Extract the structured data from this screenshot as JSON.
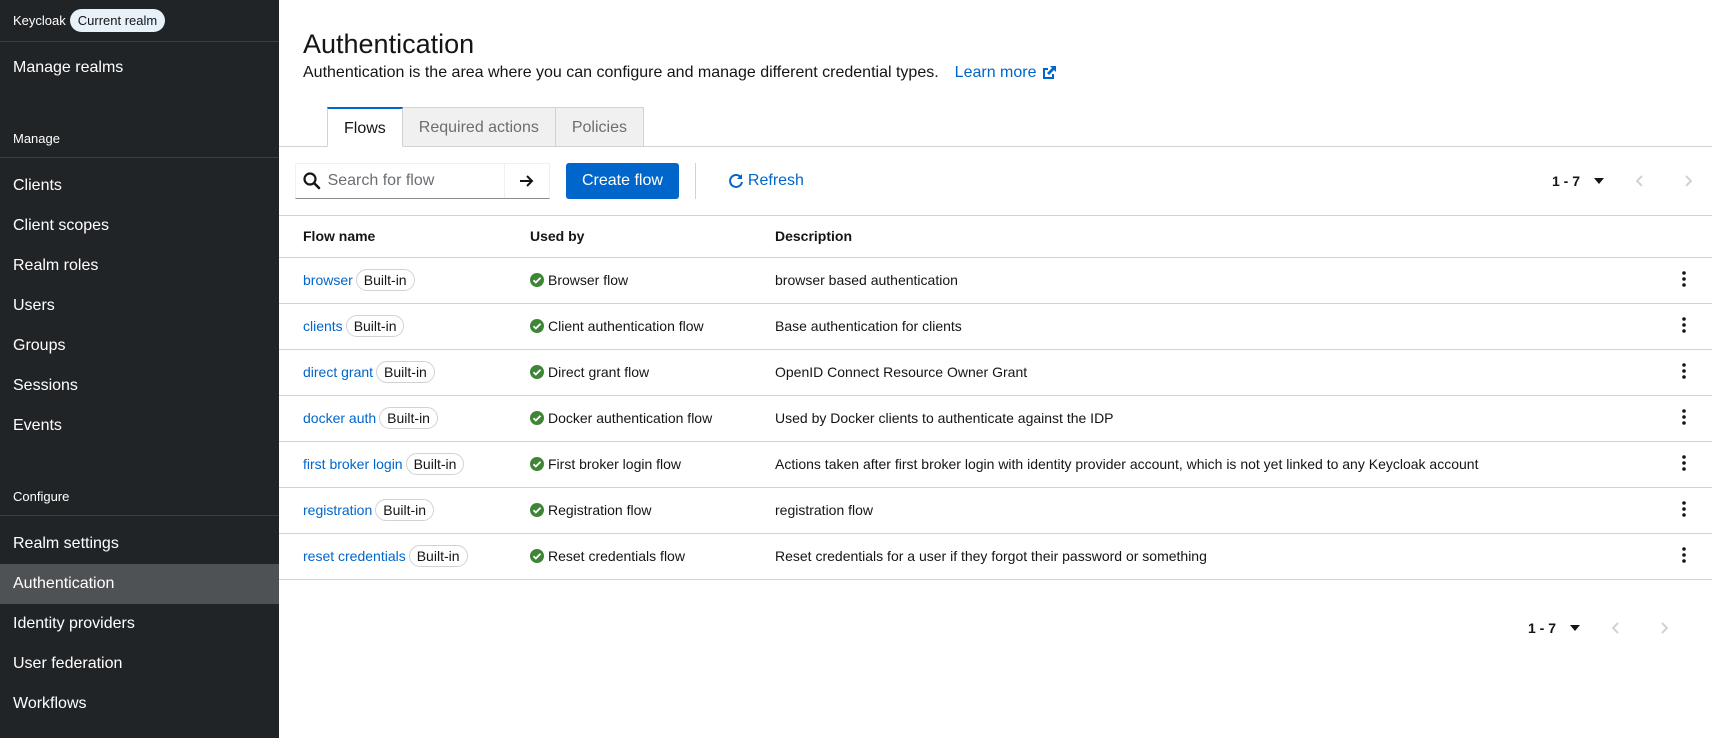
{
  "sidebar": {
    "brand": "Keycloak",
    "realm_pill": "Current realm",
    "manage_realms": "Manage realms",
    "manage_section": "Manage",
    "manage_items": [
      "Clients",
      "Client scopes",
      "Realm roles",
      "Users",
      "Groups",
      "Sessions",
      "Events"
    ],
    "configure_section": "Configure",
    "configure_items": [
      "Realm settings",
      "Authentication",
      "Identity providers",
      "User federation",
      "Workflows"
    ],
    "active_item": "Authentication"
  },
  "header": {
    "title": "Authentication",
    "subtitle": "Authentication is the area where you can configure and manage different credential types.",
    "learn_more": "Learn more"
  },
  "tabs": [
    "Flows",
    "Required actions",
    "Policies"
  ],
  "active_tab": "Flows",
  "toolbar": {
    "search_placeholder": "Search for flow",
    "create_label": "Create flow",
    "refresh_label": "Refresh",
    "pager_range": "1 - 7"
  },
  "table": {
    "headers": [
      "Flow name",
      "Used by",
      "Description"
    ],
    "rows": [
      {
        "name": "browser",
        "badge": "Built-in",
        "used_by": "Browser flow",
        "description": "browser based authentication"
      },
      {
        "name": "clients",
        "badge": "Built-in",
        "used_by": "Client authentication flow",
        "description": "Base authentication for clients"
      },
      {
        "name": "direct grant",
        "badge": "Built-in",
        "used_by": "Direct grant flow",
        "description": "OpenID Connect Resource Owner Grant"
      },
      {
        "name": "docker auth",
        "badge": "Built-in",
        "used_by": "Docker authentication flow",
        "description": "Used by Docker clients to authenticate against the IDP"
      },
      {
        "name": "first broker login",
        "badge": "Built-in",
        "used_by": "First broker login flow",
        "description": "Actions taken after first broker login with identity provider account, which is not yet linked to any Keycloak account"
      },
      {
        "name": "registration",
        "badge": "Built-in",
        "used_by": "Registration flow",
        "description": "registration flow"
      },
      {
        "name": "reset credentials",
        "badge": "Built-in",
        "used_by": "Reset credentials flow",
        "description": "Reset credentials for a user if they forgot their password or something"
      }
    ]
  },
  "footer": {
    "pager_range": "1 - 7"
  },
  "colors": {
    "sidebar_bg": "#212427",
    "active_nav": "#4f5255",
    "primary": "#0066cc",
    "success": "#3e8635"
  }
}
